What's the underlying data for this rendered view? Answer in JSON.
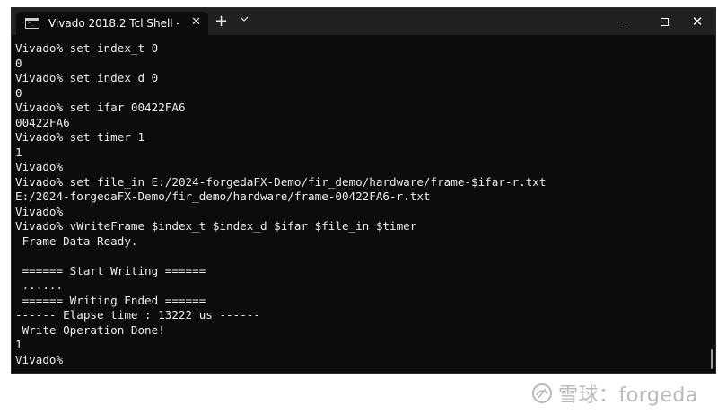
{
  "window": {
    "tab_title": "Vivado 2018.2 Tcl Shell - (",
    "tab_close": "✕",
    "new_tab": "+",
    "dropdown": "⌄",
    "close_glyph": "✕"
  },
  "console": {
    "lines": [
      "Vivado% set index_t 0",
      "0",
      "Vivado% set index_d 0",
      "0",
      "Vivado% set ifar 00422FA6",
      "00422FA6",
      "Vivado% set timer 1",
      "1",
      "Vivado%",
      "Vivado% set file_in E:/2024-forgedaFX-Demo/fir_demo/hardware/frame-$ifar-r.txt",
      "E:/2024-forgedaFX-Demo/fir_demo/hardware/frame-00422FA6-r.txt",
      "Vivado%",
      "Vivado% vWriteFrame $index_t $index_d $ifar $file_in $timer",
      " Frame Data Ready.",
      "",
      " ====== Start Writing ======",
      " ......",
      " ====== Writing Ended ======",
      "------ Elapse time : 13222 us ------",
      " Write Operation Done!",
      "1",
      "Vivado%"
    ]
  },
  "watermark": {
    "text": "雪球：forgeda"
  },
  "colors": {
    "terminal_bg": "#0c0c0c",
    "titlebar_bg": "#202020",
    "text": "#ececec"
  }
}
